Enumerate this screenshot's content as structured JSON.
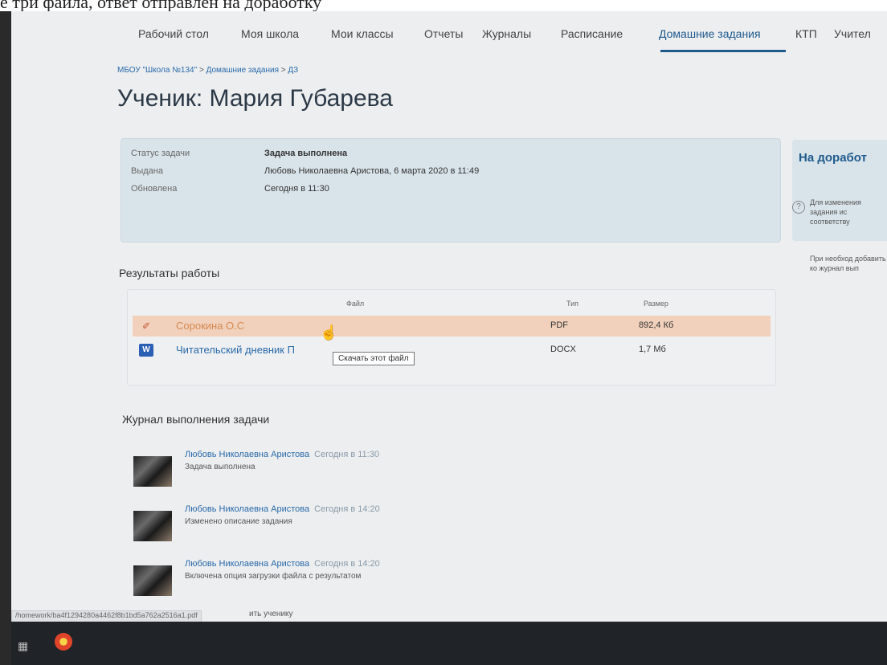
{
  "top_fragment": "е три файла, ответ отправлен на доработку",
  "nav": {
    "items": [
      {
        "label": "Рабочий стол"
      },
      {
        "label": "Моя школа"
      },
      {
        "label": "Мои классы"
      },
      {
        "label": "Отчеты"
      },
      {
        "label": "Журналы"
      },
      {
        "label": "Расписание"
      },
      {
        "label": "Домашние задания"
      },
      {
        "label": "КТП"
      },
      {
        "label": "Учител"
      }
    ],
    "active_index": 6
  },
  "breadcrumb": {
    "items": [
      "МБОУ \"Школа №134\"",
      "Домашние задания",
      "ДЗ"
    ],
    "separator": ">"
  },
  "title": "Ученик: Мария Губарева",
  "task_info": {
    "status_label": "Статус задачи",
    "status_value": "Задача выполнена",
    "issued_label": "Выдана",
    "issued_value": "Любовь Николаевна Аристова, 6 марта 2020 в 11:49",
    "updated_label": "Обновлена",
    "updated_value": "Сегодня в 11:30"
  },
  "side": {
    "button_label": "На доработ",
    "help_text_1": "Для изменения задания ис соответству",
    "help_text_2": "При необход добавить ко журнал вып"
  },
  "results": {
    "title": "Результаты работы",
    "headers": {
      "file": "Файл",
      "type": "Тип",
      "size": "Размер"
    },
    "files": [
      {
        "name": "Сорокина О.С",
        "type": "PDF",
        "size": "892,4 Кб",
        "icon": "pdf-icon"
      },
      {
        "name": "Читательский дневник П",
        "type": "DOCX",
        "size": "1,7 Мб",
        "icon": "word-icon"
      }
    ],
    "tooltip": "Скачать этот файл"
  },
  "journal": {
    "title": "Журнал выполнения задачи",
    "entries": [
      {
        "author": "Любовь Николаевна Аристова",
        "time": "Сегодня в 11:30",
        "desc": "Задача выполнена"
      },
      {
        "author": "Любовь Николаевна Аристова",
        "time": "Сегодня в 14:20",
        "desc": "Изменено описание задания"
      },
      {
        "author": "Любовь Николаевна Аристова",
        "time": "Сегодня в 14:20",
        "desc": "Включена опция загрузки файла с результатом"
      }
    ]
  },
  "status_bar": {
    "url": "/homework/ba4f1294280a4462f8b1bd5a762a2516a1.pdf",
    "tail_text": "ить ученику"
  },
  "colors": {
    "accent": "#1f5a8d",
    "link": "#2a6aa8",
    "highlight": "#f1d1bb",
    "card": "#d9e4ea"
  }
}
